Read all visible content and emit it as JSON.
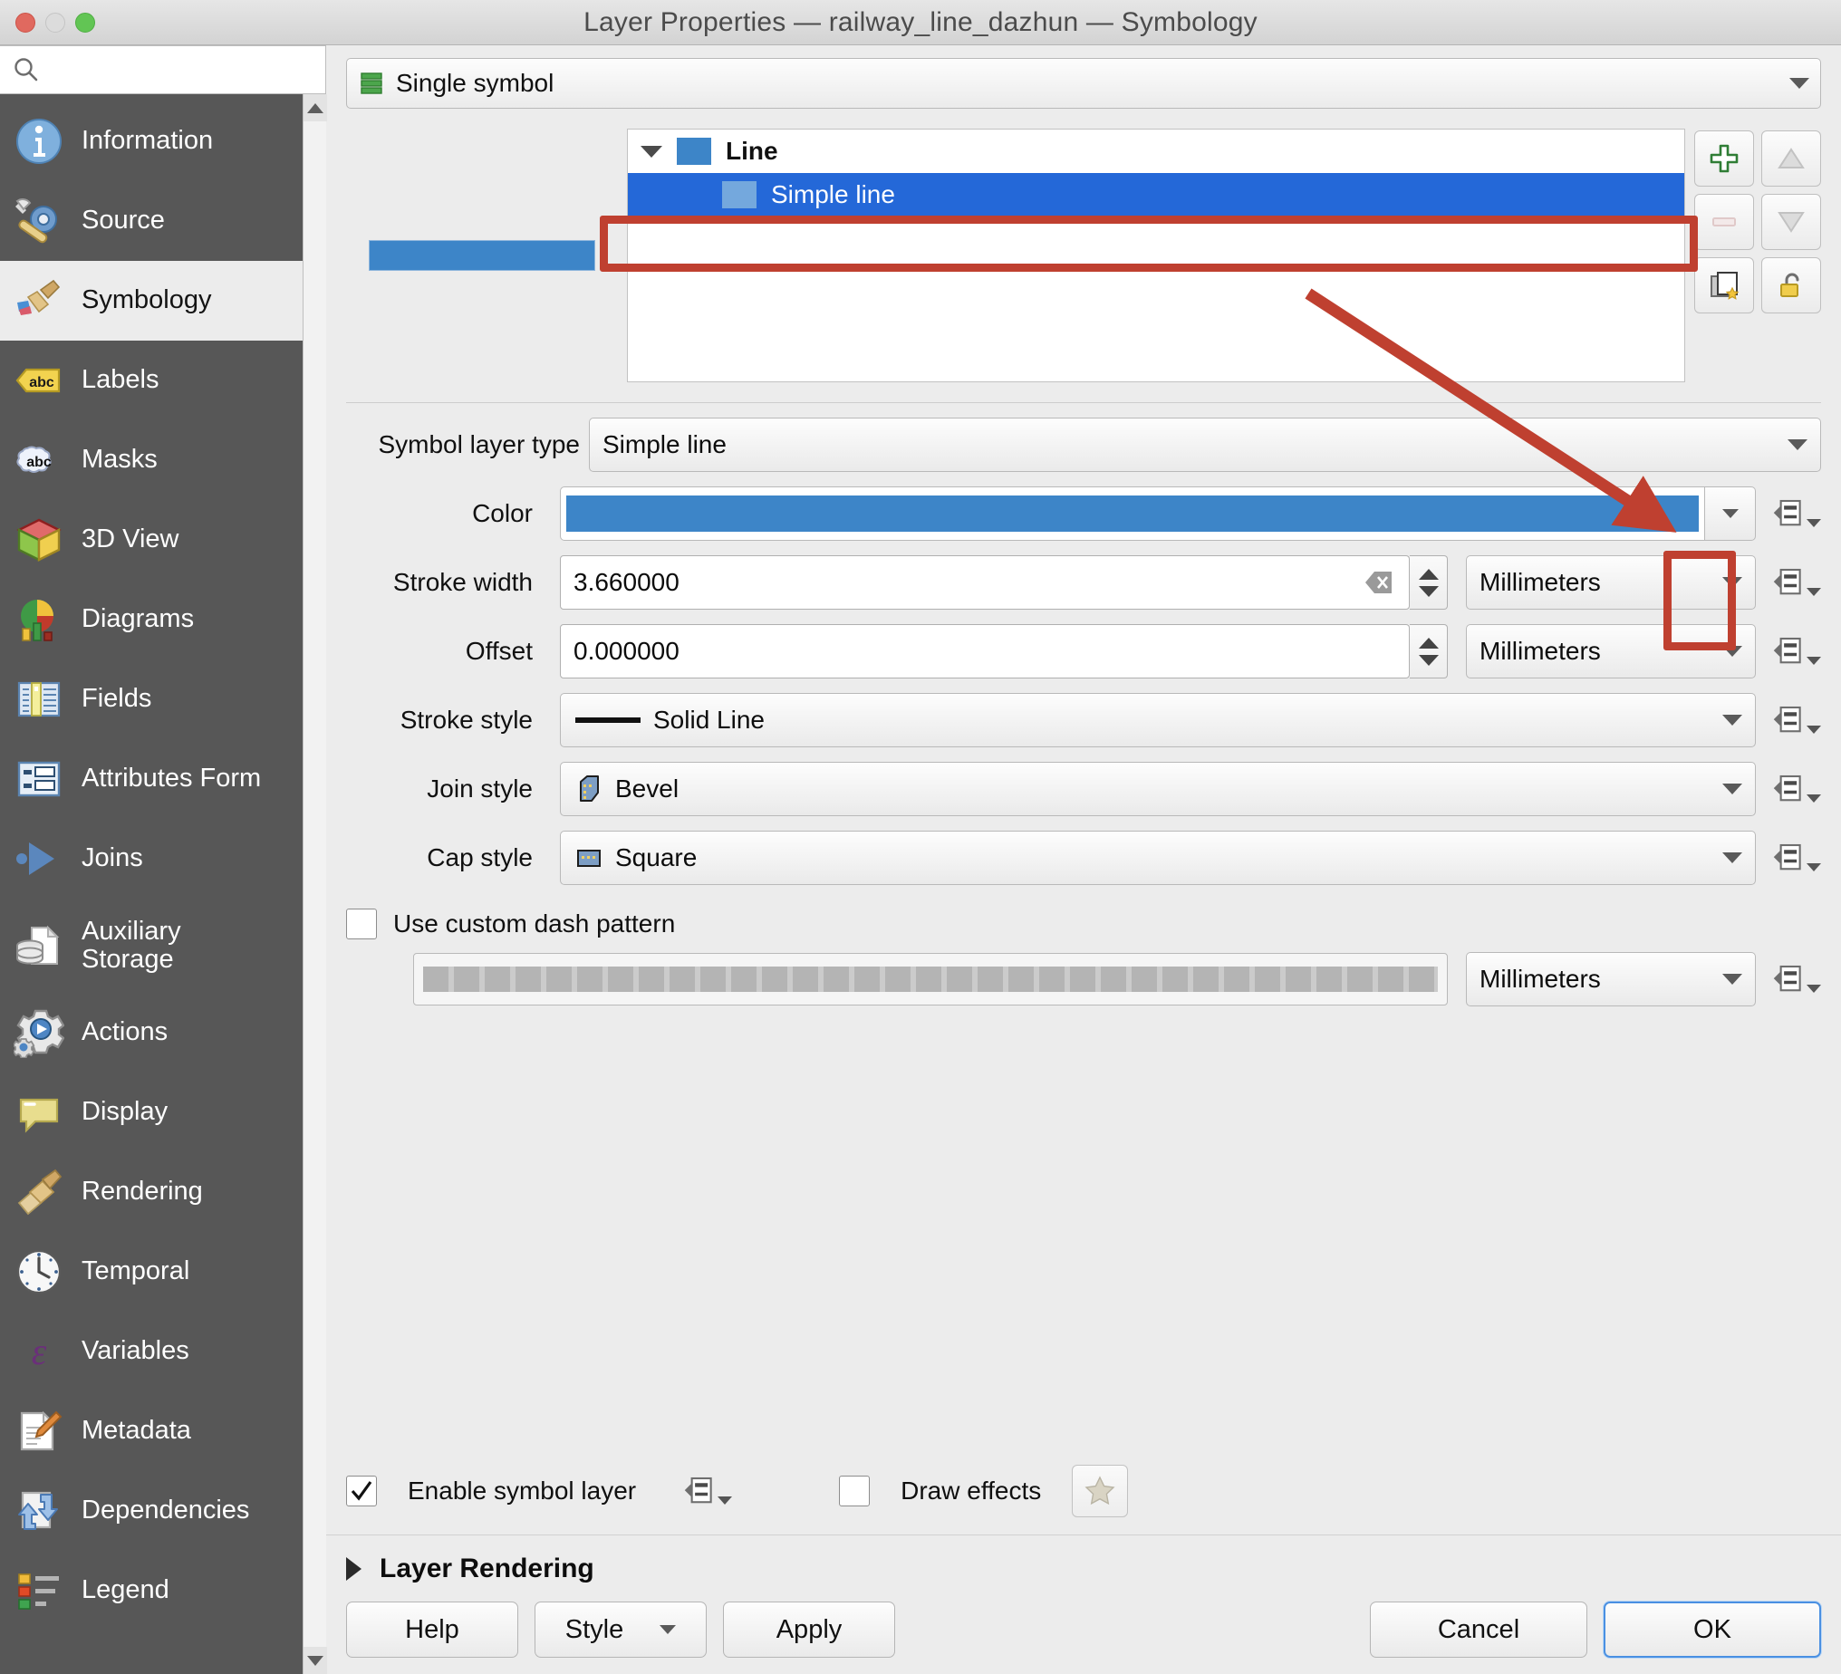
{
  "window": {
    "title": "Layer Properties — railway_line_dazhun — Symbology",
    "controls": {
      "close": "close",
      "minimize": "minimize",
      "zoom": "zoom"
    }
  },
  "sidebar": {
    "search": {
      "placeholder": "",
      "value": "",
      "icon": "search-icon"
    },
    "items": [
      {
        "label": "Information",
        "icon": "information-icon",
        "active": false
      },
      {
        "label": "Source",
        "icon": "source-icon",
        "active": false
      },
      {
        "label": "Symbology",
        "icon": "symbology-brush-icon",
        "active": true
      },
      {
        "label": "Labels",
        "icon": "labels-abc-icon",
        "active": false
      },
      {
        "label": "Masks",
        "icon": "masks-abc-icon",
        "active": false
      },
      {
        "label": "3D View",
        "icon": "cube-3d-icon",
        "active": false
      },
      {
        "label": "Diagrams",
        "icon": "diagrams-chart-icon",
        "active": false
      },
      {
        "label": "Fields",
        "icon": "fields-table-icon",
        "active": false
      },
      {
        "label": "Attributes Form",
        "icon": "attributes-form-icon",
        "active": false
      },
      {
        "label": "Joins",
        "icon": "joins-icon",
        "active": false
      },
      {
        "label": "Auxiliary\nStorage",
        "icon": "auxiliary-storage-icon",
        "active": false
      },
      {
        "label": "Actions",
        "icon": "actions-gear-icon",
        "active": false
      },
      {
        "label": "Display",
        "icon": "display-balloon-icon",
        "active": false
      },
      {
        "label": "Rendering",
        "icon": "rendering-brush-icon",
        "active": false
      },
      {
        "label": "Temporal",
        "icon": "temporal-clock-icon",
        "active": false
      },
      {
        "label": "Variables",
        "icon": "variables-epsilon-icon",
        "active": false
      },
      {
        "label": "Metadata",
        "icon": "metadata-pencil-icon",
        "active": false
      },
      {
        "label": "Dependencies",
        "icon": "dependencies-arrows-icon",
        "active": false
      },
      {
        "label": "Legend",
        "icon": "legend-list-icon",
        "active": false
      }
    ]
  },
  "renderer": {
    "label": "Single symbol",
    "icon": "single-symbol-icon"
  },
  "symbol_tree": {
    "preview_color": "#3d85c8",
    "rows": [
      {
        "label": "Line",
        "level": 0,
        "selected": false,
        "swatch": "#3d85c8"
      },
      {
        "label": "Simple line",
        "level": 1,
        "selected": true,
        "swatch": "#74a8dd"
      }
    ]
  },
  "symbol_buttons": [
    {
      "name": "add-symbol-layer-button",
      "icon": "plus-icon",
      "enabled": true
    },
    {
      "name": "move-symbol-layer-up-button",
      "icon": "arrow-up-icon",
      "enabled": false
    },
    {
      "name": "remove-symbol-layer-button",
      "icon": "minus-icon",
      "enabled": false
    },
    {
      "name": "move-symbol-layer-down-button",
      "icon": "arrow-down-icon",
      "enabled": false
    },
    {
      "name": "duplicate-symbol-layer-button",
      "icon": "duplicate-icon",
      "enabled": true
    },
    {
      "name": "lock-color-button",
      "icon": "unlock-icon",
      "enabled": true
    }
  ],
  "form": {
    "symbol_layer_type": {
      "label": "Symbol layer type",
      "value": "Simple line"
    },
    "color": {
      "label": "Color",
      "value": "#3d85c8"
    },
    "stroke_width": {
      "label": "Stroke width",
      "value": "3.660000",
      "unit": "Millimeters",
      "has_clear": true
    },
    "offset": {
      "label": "Offset",
      "value": "0.000000",
      "unit": "Millimeters",
      "has_clear": false
    },
    "stroke_style": {
      "label": "Stroke style",
      "value": "Solid Line",
      "icon": "solid-line-icon"
    },
    "join_style": {
      "label": "Join style",
      "value": "Bevel",
      "icon": "bevel-join-icon"
    },
    "cap_style": {
      "label": "Cap style",
      "value": "Square",
      "icon": "square-cap-icon"
    },
    "custom_dash": {
      "label": "Use custom dash pattern",
      "checked": false,
      "unit": "Millimeters"
    }
  },
  "footer": {
    "enable_symbol_layer": {
      "label": "Enable symbol layer",
      "checked": true
    },
    "draw_effects": {
      "label": "Draw effects",
      "checked": false
    },
    "layer_rendering": {
      "label": "Layer Rendering",
      "expanded": false
    },
    "buttons": {
      "help": "Help",
      "style": "Style",
      "apply": "Apply",
      "cancel": "Cancel",
      "ok": "OK"
    }
  },
  "annotations": {
    "color": "#bf4030",
    "highlight_symbol_layer_row": true,
    "highlight_color_dropdown": true,
    "arrow_from_symbol_row_to_color_dropdown": true
  }
}
